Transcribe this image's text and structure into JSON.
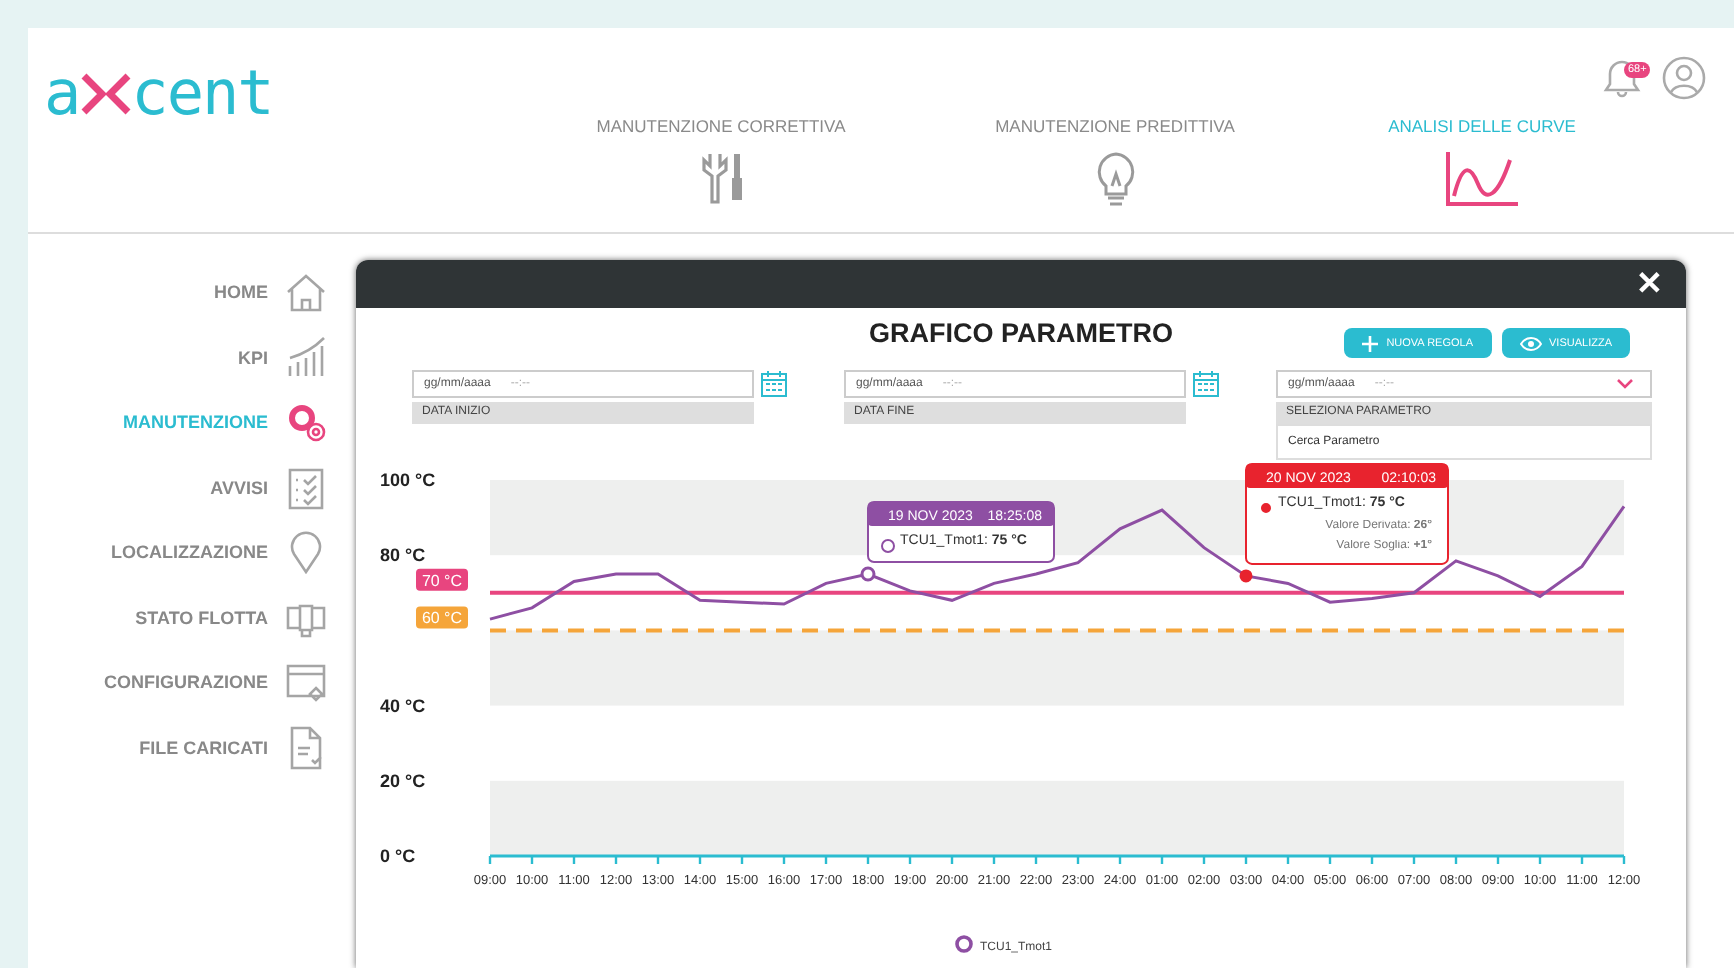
{
  "logo": {
    "before": "a",
    "after": "cent"
  },
  "notifications": {
    "badge": "68+"
  },
  "tabs": [
    {
      "label": "MANUTENZIONE CORRETTIVA",
      "selected": false
    },
    {
      "label": "MANUTENZIONE PREDITTIVA",
      "selected": false
    },
    {
      "label": "ANALISI DELLE CURVE",
      "selected": true
    }
  ],
  "sidebar": {
    "items": [
      {
        "label": "HOME",
        "selected": false
      },
      {
        "label": "KPI",
        "selected": false
      },
      {
        "label": "MANUTENZIONE",
        "selected": true
      },
      {
        "label": "AVVISI",
        "selected": false
      },
      {
        "label": "LOCALIZZAZIONE",
        "selected": false
      },
      {
        "label": "STATO FLOTTA",
        "selected": false
      },
      {
        "label": "CONFIGURAZIONE",
        "selected": false
      },
      {
        "label": "FILE CARICATI",
        "selected": false
      }
    ]
  },
  "modal": {
    "close": "✕",
    "title": "GRAFICO PARAMETRO",
    "buttons": [
      {
        "label": "NUOVA REGOLA",
        "kind": "add"
      },
      {
        "label": "VISUALIZZA",
        "kind": "view"
      }
    ],
    "filters": [
      {
        "placeholder": "gg/mm/aaaa",
        "time": "--:--",
        "label": "DATA INIZIO",
        "kind": "date"
      },
      {
        "placeholder": "gg/mm/aaaa",
        "time": "--:--",
        "label": "DATA FINE",
        "kind": "date"
      },
      {
        "placeholder": "gg/mm/aaaa",
        "time": "--:--",
        "label": "SELEZIONA PARAMETRO",
        "kind": "select",
        "options": [
          "Cerca Parametro"
        ]
      }
    ],
    "chart_data": {
      "type": "line",
      "categories": [
        "09:00",
        "10:00",
        "11:00",
        "12:00",
        "13:00",
        "14:00",
        "15:00",
        "16:00",
        "17:00",
        "18:00",
        "19:00",
        "20:00",
        "21:00",
        "22:00",
        "23:00",
        "24:00",
        "01:00",
        "02:00",
        "03:00",
        "04:00",
        "05:00",
        "06:00",
        "07:00",
        "08:00",
        "09:00",
        "10:00",
        "11:00",
        "12:00"
      ],
      "series": [
        {
          "name": "TCU1_Tmot1",
          "color": "#8e4fa3",
          "values": [
            63,
            66,
            73,
            75,
            75,
            68,
            67.5,
            67,
            72.5,
            75,
            70.5,
            68,
            72.5,
            75,
            78,
            87,
            92,
            82,
            74.5,
            72.5,
            67.5,
            68.5,
            70,
            78.5,
            74.5,
            69,
            77,
            93
          ]
        }
      ],
      "ylim": [
        0,
        100
      ],
      "yticks": [
        {
          "value": 0,
          "label": "0 °C"
        },
        {
          "value": 20,
          "label": "20 °C"
        },
        {
          "value": 40,
          "label": "40 °C"
        },
        {
          "value": 80,
          "label": "80 °C"
        },
        {
          "value": 100,
          "label": "100 °C"
        }
      ],
      "bands": [
        {
          "axis": "y",
          "from": 80,
          "to": 100
        },
        {
          "axis": "y",
          "from": 40,
          "to": 60
        },
        {
          "axis": "y",
          "from": 0,
          "to": 20
        }
      ],
      "ref_lines": [
        {
          "axis": "y",
          "value": 70,
          "label": "70 °C",
          "color": "#e8457f"
        },
        {
          "axis": "y",
          "value": 60,
          "label": "60 °C",
          "color": "#f5a53a"
        }
      ]
    },
    "tooltips": [
      {
        "date": "19 NOV 2023",
        "time": "18:25:08",
        "text": "TCU1_Tmot1: **75 °C**",
        "color": "#8e4fa3",
        "kind": "ring"
      },
      {
        "date": "20 NOV 2023",
        "time": "02:10:03",
        "text": "TCU1_Tmot1: **75 °C**",
        "lines": [
          "Valore Derivata: **26°**",
          "Valore Soglia: **+1°**"
        ],
        "color": "#e8232e",
        "kind": "dot"
      }
    ]
  }
}
